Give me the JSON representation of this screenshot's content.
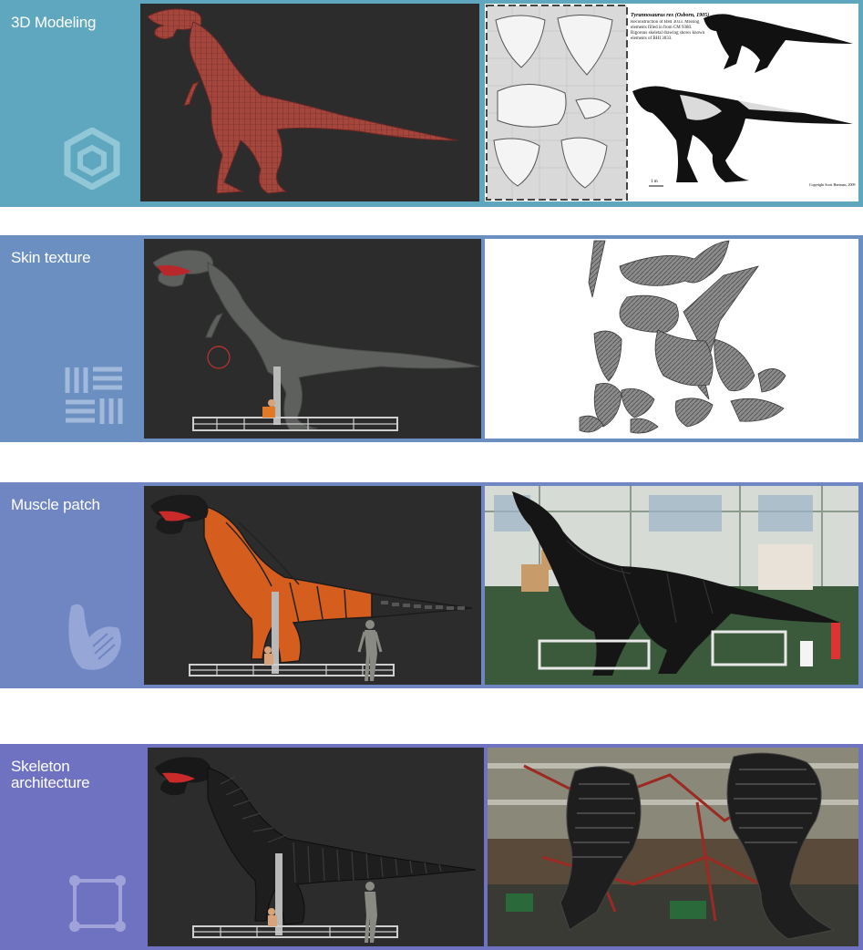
{
  "sections": [
    {
      "id": "modeling",
      "title": "3D Modeling",
      "icon": "cube-icon",
      "color": "#5fa7bf",
      "left_view": "dark textured T-rex wireframe model",
      "right_view": "skeletal reconstruction reference sheet"
    },
    {
      "id": "skin",
      "title": "Skin texture",
      "icon": "texture-pattern-icon",
      "color": "#6a8fc0",
      "left_view": "grey sculpted T-rex on ride base",
      "right_view": "unwrapped skin UV map"
    },
    {
      "id": "muscle",
      "title": "Muscle patch",
      "icon": "arm-muscle-icon",
      "color": "#6f86c3",
      "left_view": "orange muscle model on ride base",
      "right_view": "workshop photo of fabric muscle body"
    },
    {
      "id": "skeleton",
      "title": "Skeleton\narchitecture",
      "icon": "bounding-frame-icon",
      "color": "#6e72c0",
      "left_view": "black skeleton frame model",
      "right_view": "workshop photo of steel skeleton"
    }
  ],
  "reference_sheet": {
    "caption_title": "Tyrannosaurus rex (Osborn, 1905)",
    "caption_body": "Reconstruction of BHI 3033. Missing elements filled in from CM 9380. Rigorous skeletal drawing shows known elements of BHI 3033.",
    "scale": "1 m",
    "copyright": "Copyright Scott Hartman, 2009"
  }
}
